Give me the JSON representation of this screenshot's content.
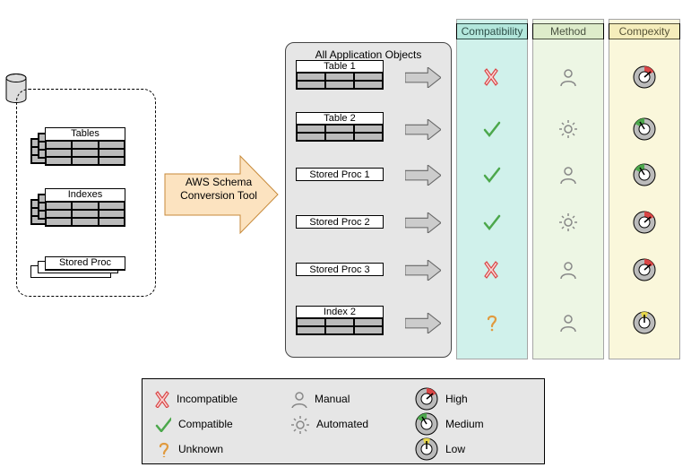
{
  "source": {
    "tables_label": "Tables",
    "indexes_label": "Indexes",
    "stored_proc_label": "Stored Proc"
  },
  "arrow_label": "AWS Schema Conversion Tool",
  "columns": {
    "compatibility": "Compatibility",
    "method": "Method",
    "complexity": "Compexity"
  },
  "objects_panel_title": "All Application Objects",
  "objects": [
    {
      "label": "Table 1",
      "compatibility": "incompatible",
      "method": "manual",
      "complexity": "high",
      "has_grid": true
    },
    {
      "label": "Table 2",
      "compatibility": "compatible",
      "method": "automated",
      "complexity": "medium",
      "has_grid": true
    },
    {
      "label": "Stored Proc 1",
      "compatibility": "compatible",
      "method": "manual",
      "complexity": "medium",
      "has_grid": false
    },
    {
      "label": "Stored Proc 2",
      "compatibility": "compatible",
      "method": "automated",
      "complexity": "high",
      "has_grid": false
    },
    {
      "label": "Stored Proc 3",
      "compatibility": "incompatible",
      "method": "manual",
      "complexity": "high",
      "has_grid": false
    },
    {
      "label": "Index 2",
      "compatibility": "unknown",
      "method": "manual",
      "complexity": "low",
      "has_grid": true
    }
  ],
  "legend": {
    "incompatible": "Incompatible",
    "compatible": "Compatible",
    "unknown": "Unknown",
    "manual": "Manual",
    "automated": "Automated",
    "high": "High",
    "medium": "Medium",
    "low": "Low"
  }
}
